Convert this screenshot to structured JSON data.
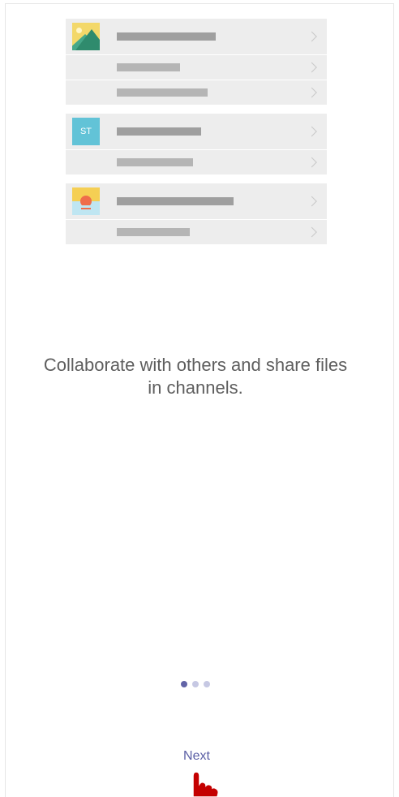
{
  "caption": {
    "line1": "Collaborate with others and share files",
    "line2": "in channels."
  },
  "illustration": {
    "groups": [
      {
        "thumb_icon": "landscape-image-icon",
        "rows": 3
      },
      {
        "thumb_icon": "team-avatar-icon",
        "thumb_text": "ST",
        "rows": 2
      },
      {
        "thumb_icon": "sunset-image-icon",
        "rows": 2
      }
    ]
  },
  "pager": {
    "count": 3,
    "active_index": 0,
    "active_color": "#6264a7",
    "inactive_color": "#c6c8e3"
  },
  "next_button": {
    "label": "Next"
  },
  "colors": {
    "accent": "#5b5fa5",
    "caption_text": "#5e5e5e",
    "row_background": "#ededed",
    "cursor_hand": "#c40000"
  }
}
